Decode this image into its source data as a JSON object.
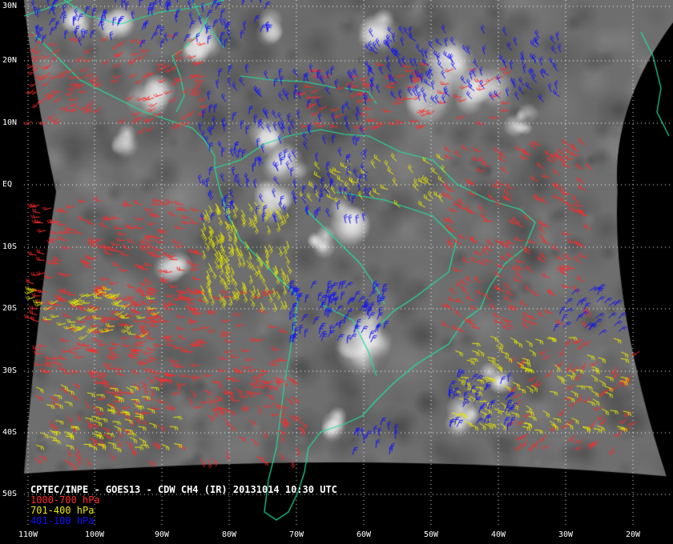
{
  "colors": {
    "background": "#000000",
    "cloud_gray": "#7a7a7a",
    "coastline": "#22dd99",
    "grid": "#ffffff",
    "low_level_wind": "#ff2a2a",
    "mid_level_wind": "#e8e800",
    "high_level_wind": "#1010ff"
  },
  "caption": {
    "title": "CPTEC/INPE - GOES13 - CDW CH4 (IR) 20131014 10:30 UTC"
  },
  "legend": [
    {
      "label": "1000-700 hPa",
      "color": "#ff2a2a"
    },
    {
      "label": "701-400 hPa",
      "color": "#e8e800"
    },
    {
      "label": "401-100 hPa",
      "color": "#1010ff"
    }
  ],
  "latitude_labels": [
    "30N",
    "20N",
    "10N",
    "EQ",
    "10S",
    "20S",
    "30S",
    "40S",
    "50S"
  ],
  "longitude_labels": [
    "110W",
    "100W",
    "90W",
    "80W",
    "70W",
    "60W",
    "50W",
    "40W",
    "30W",
    "20W"
  ],
  "icons": {
    "wind_barb": "wind-barb-icon",
    "coastline": "coastline-outline"
  }
}
